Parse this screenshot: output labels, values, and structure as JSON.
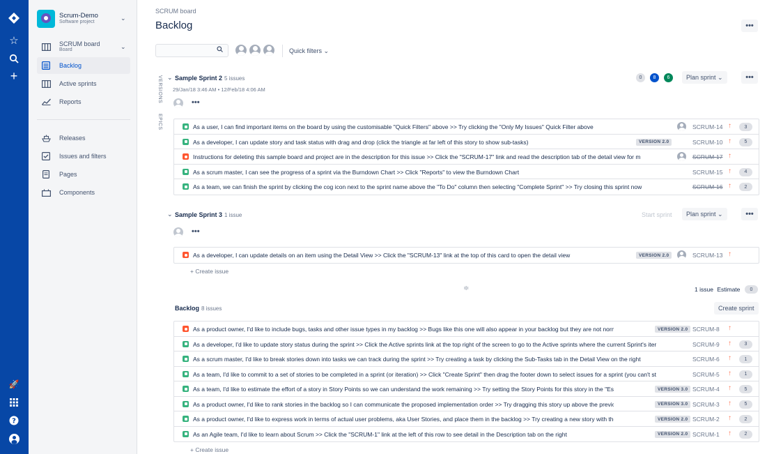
{
  "sidebar": {
    "project_name": "Scrum-Demo",
    "project_type": "Software project",
    "board_name": "SCRUM board",
    "board_type": "Board",
    "items": [
      {
        "label": "Backlog"
      },
      {
        "label": "Active sprints"
      },
      {
        "label": "Reports"
      },
      {
        "label": "Releases"
      },
      {
        "label": "Issues and filters"
      },
      {
        "label": "Pages"
      },
      {
        "label": "Components"
      }
    ]
  },
  "header": {
    "breadcrumb": "SCRUM board",
    "title": "Backlog",
    "more": "•••"
  },
  "toolbar": {
    "search_value": "",
    "quick_filters": "Quick filters ⌄"
  },
  "side_tabs": {
    "versions": "VERSIONS",
    "epics": "EPICS"
  },
  "sprint2": {
    "name": "Sample Sprint 2",
    "count": "5 issues",
    "dates": "29/Jan/18 3:46 AM • 12/Feb/18 4:06 AM",
    "pills": [
      "0",
      "8",
      "6"
    ],
    "plan_label": "Plan sprint ⌄",
    "more": "•••",
    "issues": [
      {
        "type": "story",
        "summary": "As a user, I can find important items on the board by using the customisable \"Quick Filters\" above >> Try clicking the \"Only My Issues\" Quick Filter above",
        "version": "",
        "key": "SCRUM-14",
        "done": false,
        "est": "3",
        "avatar": true
      },
      {
        "type": "story",
        "summary": "As a developer, I can update story and task status with drag and drop (click the triangle at far left of this story to show sub-tasks)",
        "version": "VERSION 2.0",
        "key": "SCRUM-10",
        "done": false,
        "est": "5",
        "avatar": false
      },
      {
        "type": "bug",
        "summary": "Instructions for deleting this sample board and project are in the description for this issue >> Click the \"SCRUM-17\" link and read the description tab of the detail view for m",
        "version": "",
        "key": "SCRUM-17",
        "done": true,
        "est": "",
        "avatar": true
      },
      {
        "type": "story",
        "summary": "As a scrum master, I can see the progress of a sprint via the Burndown Chart >> Click \"Reports\" to view the Burndown Chart",
        "version": "",
        "key": "SCRUM-15",
        "done": false,
        "est": "4",
        "avatar": false
      },
      {
        "type": "story",
        "summary": "As a team, we can finish the sprint by clicking the cog icon next to the sprint name above the \"To Do\" column then selecting \"Complete Sprint\" >> Try closing this sprint now",
        "version": "",
        "key": "SCRUM-16",
        "done": true,
        "est": "2",
        "avatar": false
      }
    ]
  },
  "sprint3": {
    "name": "Sample Sprint 3",
    "count": "1 issue",
    "start_label": "Start sprint",
    "plan_label": "Plan sprint ⌄",
    "more": "•••",
    "issues": [
      {
        "type": "bug",
        "summary": "As a developer, I can update details on an item using the Detail View >> Click the \"SCRUM-13\" link at the top of this card to open the detail view",
        "version": "VERSION 2.0",
        "key": "SCRUM-13",
        "done": false,
        "est": "",
        "avatar": true
      }
    ],
    "create_issue": "+ Create issue",
    "summary_count": "1 issue",
    "summary_est_label": "Estimate",
    "summary_est": "0"
  },
  "backlog": {
    "name": "Backlog",
    "count": "8 issues",
    "create_sprint": "Create sprint",
    "issues": [
      {
        "type": "bug",
        "summary": "As a product owner, I'd like to include bugs, tasks and other issue types in my backlog >> Bugs like this one will also appear in your backlog but they are not normal",
        "version": "VERSION 2.0",
        "key": "SCRUM-8",
        "done": false,
        "est": "",
        "avatar": false
      },
      {
        "type": "story",
        "summary": "As a developer, I'd like to update story status during the sprint >> Click the Active sprints link at the top right of the screen to go to the Active sprints where the current Sprint's iter",
        "version": "",
        "key": "SCRUM-9",
        "done": false,
        "est": "3",
        "avatar": false
      },
      {
        "type": "story",
        "summary": "As a scrum master, I'd like to break stories down into tasks we can track during the sprint >> Try creating a task by clicking the Sub-Tasks tab in the Detail View on the right",
        "version": "",
        "key": "SCRUM-6",
        "done": false,
        "est": "1",
        "avatar": false
      },
      {
        "type": "story",
        "summary": "As a team, I'd like to commit to a set of stories to be completed in a sprint (or iteration) >> Click \"Create Sprint\" then drag the footer down to select issues for a sprint (you can't st",
        "version": "",
        "key": "SCRUM-5",
        "done": false,
        "est": "1",
        "avatar": false
      },
      {
        "type": "story",
        "summary": "As a team, I'd like to estimate the effort of a story in Story Points so we can understand the work remaining >> Try setting the Story Points for this story in the \"Estim",
        "version": "VERSION 3.0",
        "key": "SCRUM-4",
        "done": false,
        "est": "5",
        "avatar": false
      },
      {
        "type": "story",
        "summary": "As a product owner, I'd like to rank stories in the backlog so I can communicate the proposed implementation order >> Try dragging this story up above the previou",
        "version": "VERSION 3.0",
        "key": "SCRUM-3",
        "done": false,
        "est": "5",
        "avatar": false
      },
      {
        "type": "story",
        "summary": "As a product owner, I'd like to express work in terms of actual user problems, aka User Stories, and place them in the backlog >> Try creating a new story with the \"+",
        "version": "VERSION 2.0",
        "key": "SCRUM-2",
        "done": false,
        "est": "2",
        "avatar": false
      },
      {
        "type": "story",
        "summary": "As an Agile team, I'd like to learn about Scrum >> Click the \"SCRUM-1\" link at the left of this row to see detail in the Description tab on the right",
        "version": "VERSION 2.0",
        "key": "SCRUM-1",
        "done": false,
        "est": "2",
        "avatar": false
      }
    ],
    "create_issue": "+ Create issue"
  },
  "colors": {
    "nav": "#0747A6",
    "accent": "#0052CC",
    "story": "#36B37E",
    "bug": "#FF5630",
    "priority": "#FF7452",
    "pill_grey": "#DFE1E6",
    "pill_blue": "#0052CC",
    "pill_green": "#00875A"
  }
}
